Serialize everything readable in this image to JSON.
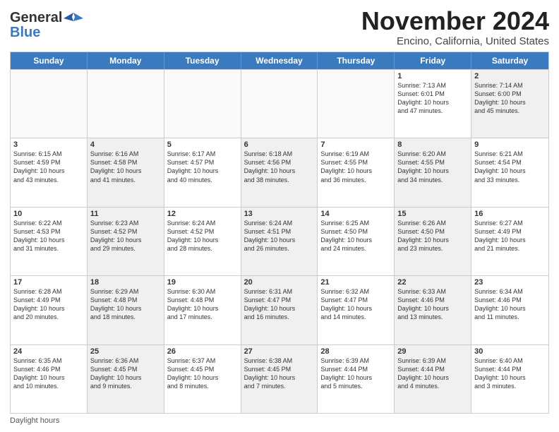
{
  "header": {
    "logo_line1": "General",
    "logo_line2": "Blue",
    "month_title": "November 2024",
    "location": "Encino, California, United States"
  },
  "weekdays": [
    "Sunday",
    "Monday",
    "Tuesday",
    "Wednesday",
    "Thursday",
    "Friday",
    "Saturday"
  ],
  "rows": [
    [
      {
        "day": "",
        "info": "",
        "shaded": false,
        "empty": true
      },
      {
        "day": "",
        "info": "",
        "shaded": false,
        "empty": true
      },
      {
        "day": "",
        "info": "",
        "shaded": false,
        "empty": true
      },
      {
        "day": "",
        "info": "",
        "shaded": false,
        "empty": true
      },
      {
        "day": "",
        "info": "",
        "shaded": false,
        "empty": true
      },
      {
        "day": "1",
        "info": "Sunrise: 7:13 AM\nSunset: 6:01 PM\nDaylight: 10 hours\nand 47 minutes.",
        "shaded": false,
        "empty": false
      },
      {
        "day": "2",
        "info": "Sunrise: 7:14 AM\nSunset: 6:00 PM\nDaylight: 10 hours\nand 45 minutes.",
        "shaded": true,
        "empty": false
      }
    ],
    [
      {
        "day": "3",
        "info": "Sunrise: 6:15 AM\nSunset: 4:59 PM\nDaylight: 10 hours\nand 43 minutes.",
        "shaded": false,
        "empty": false
      },
      {
        "day": "4",
        "info": "Sunrise: 6:16 AM\nSunset: 4:58 PM\nDaylight: 10 hours\nand 41 minutes.",
        "shaded": true,
        "empty": false
      },
      {
        "day": "5",
        "info": "Sunrise: 6:17 AM\nSunset: 4:57 PM\nDaylight: 10 hours\nand 40 minutes.",
        "shaded": false,
        "empty": false
      },
      {
        "day": "6",
        "info": "Sunrise: 6:18 AM\nSunset: 4:56 PM\nDaylight: 10 hours\nand 38 minutes.",
        "shaded": true,
        "empty": false
      },
      {
        "day": "7",
        "info": "Sunrise: 6:19 AM\nSunset: 4:55 PM\nDaylight: 10 hours\nand 36 minutes.",
        "shaded": false,
        "empty": false
      },
      {
        "day": "8",
        "info": "Sunrise: 6:20 AM\nSunset: 4:55 PM\nDaylight: 10 hours\nand 34 minutes.",
        "shaded": true,
        "empty": false
      },
      {
        "day": "9",
        "info": "Sunrise: 6:21 AM\nSunset: 4:54 PM\nDaylight: 10 hours\nand 33 minutes.",
        "shaded": false,
        "empty": false
      }
    ],
    [
      {
        "day": "10",
        "info": "Sunrise: 6:22 AM\nSunset: 4:53 PM\nDaylight: 10 hours\nand 31 minutes.",
        "shaded": false,
        "empty": false
      },
      {
        "day": "11",
        "info": "Sunrise: 6:23 AM\nSunset: 4:52 PM\nDaylight: 10 hours\nand 29 minutes.",
        "shaded": true,
        "empty": false
      },
      {
        "day": "12",
        "info": "Sunrise: 6:24 AM\nSunset: 4:52 PM\nDaylight: 10 hours\nand 28 minutes.",
        "shaded": false,
        "empty": false
      },
      {
        "day": "13",
        "info": "Sunrise: 6:24 AM\nSunset: 4:51 PM\nDaylight: 10 hours\nand 26 minutes.",
        "shaded": true,
        "empty": false
      },
      {
        "day": "14",
        "info": "Sunrise: 6:25 AM\nSunset: 4:50 PM\nDaylight: 10 hours\nand 24 minutes.",
        "shaded": false,
        "empty": false
      },
      {
        "day": "15",
        "info": "Sunrise: 6:26 AM\nSunset: 4:50 PM\nDaylight: 10 hours\nand 23 minutes.",
        "shaded": true,
        "empty": false
      },
      {
        "day": "16",
        "info": "Sunrise: 6:27 AM\nSunset: 4:49 PM\nDaylight: 10 hours\nand 21 minutes.",
        "shaded": false,
        "empty": false
      }
    ],
    [
      {
        "day": "17",
        "info": "Sunrise: 6:28 AM\nSunset: 4:49 PM\nDaylight: 10 hours\nand 20 minutes.",
        "shaded": false,
        "empty": false
      },
      {
        "day": "18",
        "info": "Sunrise: 6:29 AM\nSunset: 4:48 PM\nDaylight: 10 hours\nand 18 minutes.",
        "shaded": true,
        "empty": false
      },
      {
        "day": "19",
        "info": "Sunrise: 6:30 AM\nSunset: 4:48 PM\nDaylight: 10 hours\nand 17 minutes.",
        "shaded": false,
        "empty": false
      },
      {
        "day": "20",
        "info": "Sunrise: 6:31 AM\nSunset: 4:47 PM\nDaylight: 10 hours\nand 16 minutes.",
        "shaded": true,
        "empty": false
      },
      {
        "day": "21",
        "info": "Sunrise: 6:32 AM\nSunset: 4:47 PM\nDaylight: 10 hours\nand 14 minutes.",
        "shaded": false,
        "empty": false
      },
      {
        "day": "22",
        "info": "Sunrise: 6:33 AM\nSunset: 4:46 PM\nDaylight: 10 hours\nand 13 minutes.",
        "shaded": true,
        "empty": false
      },
      {
        "day": "23",
        "info": "Sunrise: 6:34 AM\nSunset: 4:46 PM\nDaylight: 10 hours\nand 11 minutes.",
        "shaded": false,
        "empty": false
      }
    ],
    [
      {
        "day": "24",
        "info": "Sunrise: 6:35 AM\nSunset: 4:46 PM\nDaylight: 10 hours\nand 10 minutes.",
        "shaded": false,
        "empty": false
      },
      {
        "day": "25",
        "info": "Sunrise: 6:36 AM\nSunset: 4:45 PM\nDaylight: 10 hours\nand 9 minutes.",
        "shaded": true,
        "empty": false
      },
      {
        "day": "26",
        "info": "Sunrise: 6:37 AM\nSunset: 4:45 PM\nDaylight: 10 hours\nand 8 minutes.",
        "shaded": false,
        "empty": false
      },
      {
        "day": "27",
        "info": "Sunrise: 6:38 AM\nSunset: 4:45 PM\nDaylight: 10 hours\nand 7 minutes.",
        "shaded": true,
        "empty": false
      },
      {
        "day": "28",
        "info": "Sunrise: 6:39 AM\nSunset: 4:44 PM\nDaylight: 10 hours\nand 5 minutes.",
        "shaded": false,
        "empty": false
      },
      {
        "day": "29",
        "info": "Sunrise: 6:39 AM\nSunset: 4:44 PM\nDaylight: 10 hours\nand 4 minutes.",
        "shaded": true,
        "empty": false
      },
      {
        "day": "30",
        "info": "Sunrise: 6:40 AM\nSunset: 4:44 PM\nDaylight: 10 hours\nand 3 minutes.",
        "shaded": false,
        "empty": false
      }
    ]
  ],
  "legend": "Daylight hours"
}
